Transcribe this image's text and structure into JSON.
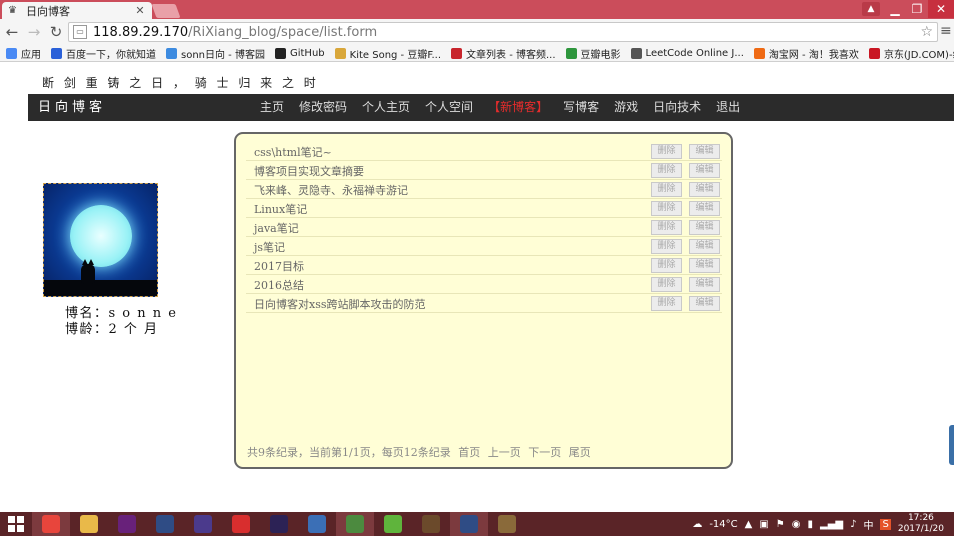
{
  "browser": {
    "tab_title": "日向博客",
    "url_host": "118.89.29.170",
    "url_path": "/RiXiang_blog/space/list.form",
    "bookmarks": [
      {
        "label": "应用",
        "icon": "apps-icon",
        "color": "#4a8af4"
      },
      {
        "label": "百度一下，你就知道",
        "icon": "baidu-icon",
        "color": "#2a60d8"
      },
      {
        "label": "sonn日向 - 博客园",
        "icon": "cnblogs-icon",
        "color": "#3d8be0"
      },
      {
        "label": "GitHub",
        "icon": "github-icon",
        "color": "#222222"
      },
      {
        "label": "Kite Song - 豆瓣F...",
        "icon": "douban-fm-icon",
        "color": "#d9a73a"
      },
      {
        "label": "文章列表 - 博客频...",
        "icon": "csdn-icon",
        "color": "#c8252c"
      },
      {
        "label": "豆瓣电影",
        "icon": "douban-icon",
        "color": "#2e963d"
      },
      {
        "label": "LeetCode Online J...",
        "icon": "leetcode-icon",
        "color": "#555555"
      },
      {
        "label": "淘宝网 - 淘！我喜欢",
        "icon": "taobao-icon",
        "color": "#ef6a14"
      },
      {
        "label": "京东(JD.COM)-综...",
        "icon": "jd-icon",
        "color": "#c91623"
      }
    ]
  },
  "site": {
    "slogan": "断 剑 重 铸 之 日 ， 骑 士 归 来 之 时",
    "brand": "日向博客",
    "menu": [
      {
        "label": "主页",
        "active": false
      },
      {
        "label": "修改密码",
        "active": false
      },
      {
        "label": "个人主页",
        "active": false
      },
      {
        "label": "个人空间",
        "active": false
      },
      {
        "label": "【新博客】",
        "active": true
      },
      {
        "label": "写博客",
        "active": false
      },
      {
        "label": "游戏",
        "active": false
      },
      {
        "label": "日向技术",
        "active": false
      },
      {
        "label": "退出",
        "active": false
      }
    ]
  },
  "profile": {
    "name_line": "博名：s o n n e",
    "age_line": "博龄：2 个 月"
  },
  "posts": {
    "delete_label": "删除",
    "edit_label": "编辑",
    "items": [
      "css\\html笔记~",
      "博客项目实现文章摘要",
      "飞来峰、灵隐寺、永福禅寺游记",
      "Linux笔记",
      "java笔记",
      "js笔记",
      "2017目标",
      "2016总结",
      "日向博客对xss跨站脚本攻击的防范"
    ]
  },
  "pager": {
    "summary": "共9条纪录，当前第1/1页，每页12条纪录",
    "first": "首页",
    "prev": "上一页",
    "next": "下一页",
    "last": "尾页"
  },
  "taskbar": {
    "apps": [
      {
        "icon": "chrome-icon",
        "color": "#e8453c",
        "active": true
      },
      {
        "icon": "file-explorer-icon",
        "color": "#e9b949",
        "active": false
      },
      {
        "icon": "visual-studio-icon",
        "color": "#68217a",
        "active": false
      },
      {
        "icon": "eclipse-8-icon",
        "color": "#2f4c85",
        "active": false
      },
      {
        "icon": "eclipse-icon",
        "color": "#4b3a8c",
        "active": false
      },
      {
        "icon": "netease-music-icon",
        "color": "#d82e2e",
        "active": false
      },
      {
        "icon": "eclipse-ee-icon",
        "color": "#2c2255",
        "active": false
      },
      {
        "icon": "network-icon",
        "color": "#3b6fb6",
        "active": false
      },
      {
        "icon": "remote-desktop-icon",
        "color": "#4c8a3f",
        "active": true
      },
      {
        "icon": "frog-icon",
        "color": "#5fb43c",
        "active": false
      },
      {
        "icon": "game-icon",
        "color": "#6b4a2b",
        "active": false
      },
      {
        "icon": "eclipse-8b-icon",
        "color": "#2f4c85",
        "active": true
      },
      {
        "icon": "settings-app-icon",
        "color": "#8a6a3a",
        "active": false
      }
    ],
    "weather": "-14°C",
    "ime": "中",
    "time": "17:26",
    "date": "2017/1/20"
  }
}
